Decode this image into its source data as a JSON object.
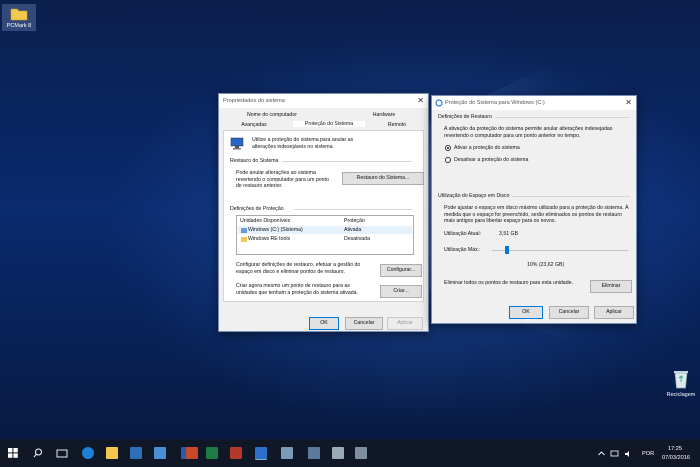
{
  "desktop": {
    "icons": [
      {
        "label": "PCMark 8",
        "icon": "folder-icon"
      },
      {
        "label": "Reciclagem",
        "icon": "recycle-bin-icon"
      }
    ]
  },
  "sys_props": {
    "title": "Propriedades do sistema",
    "tabs_top": [
      "Nome do computador",
      "Hardware"
    ],
    "tabs_bottom": [
      "Avançadas",
      "Proteção do Sistema",
      "Remoto"
    ],
    "intro": "Utilize a proteção do sistema para anular as alterações indesejáveis no sistema.",
    "restore_group": "Restauro do Sistema",
    "restore_text": "Pode anular alterações ao sistema revertendo o computador para um ponto de restauro anterior.",
    "restore_button": "Restauro do Sistema...",
    "protection_group": "Definições de Proteção",
    "list_headers": [
      "Unidades Disponíveis",
      "Proteção"
    ],
    "drives": [
      {
        "name": "Windows (C:) (Sistema)",
        "status": "Ativada"
      },
      {
        "name": "Windows RE tools",
        "status": "Desativada"
      }
    ],
    "configure_text": "Configurar definições de restauro, efetuar a gestão do espaço em disco e eliminar pontos de restauro.",
    "configure_button": "Configurar...",
    "create_text": "Criar agora mesmo um ponto de restauro para as unidades que tenham a proteção do sistema ativada.",
    "create_button": "Criar...",
    "ok": "OK",
    "cancel": "Cancelar",
    "apply": "Aplicar"
  },
  "protection_win": {
    "title": "Proteção do Sistema para Windows (C:)",
    "restore_settings": "Definições de Restauro",
    "restore_desc": "A ativação da proteção do sistema permite anular alterações indesejadas revertendo o computador para um ponto anterior no tempo.",
    "radio_on": "Ativar a proteção do sistema",
    "radio_off": "Desativar a proteção do sistema",
    "disk_usage": "Utilização do Espaço em Disco",
    "disk_desc": "Pode ajustar o espaço em disco máximo utilizado para a proteção do sistema. À medida que o espaço for preenchido, serão eliminados os pontos de restauro mais antigos para libertar espaço para os novos.",
    "current_label": "Utilização Atual:",
    "current_value": "3,51 GB",
    "max_label": "Utilização Máx.:",
    "slider_percent": 10,
    "slider_text": "10% (23,62 GB)",
    "delete_text": "Eliminar todos os pontos de restauro para esta unidade.",
    "delete_button": "Eliminar",
    "ok": "OK",
    "cancel": "Cancelar",
    "apply": "Aplicar"
  },
  "taskbar": {
    "language": "POR",
    "time": "17:25",
    "date": "07/03/2016"
  }
}
